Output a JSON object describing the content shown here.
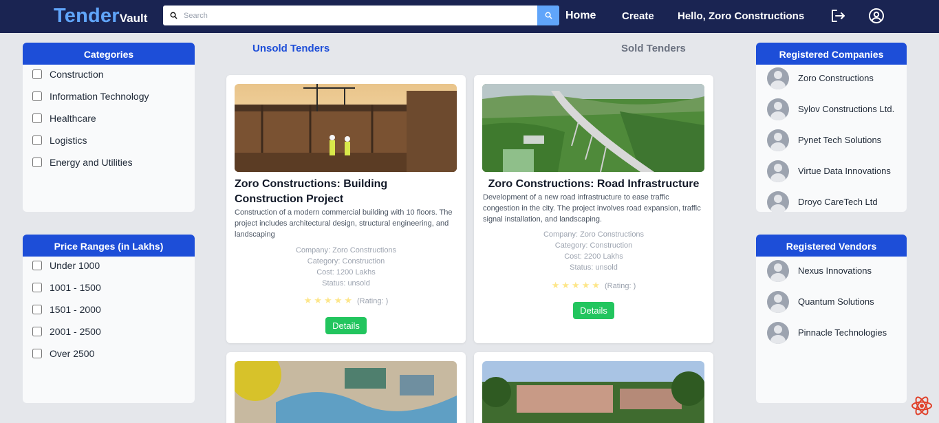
{
  "brand": {
    "main": "Tender",
    "sub": "Vault"
  },
  "search": {
    "placeholder": "Search"
  },
  "nav": {
    "home": "Home",
    "create": "Create",
    "greeting": "Hello, Zoro Constructions"
  },
  "categories": {
    "title": "Categories",
    "items": [
      "Construction",
      "Information Technology",
      "Healthcare",
      "Logistics",
      "Energy and Utilities"
    ]
  },
  "price_ranges": {
    "title": "Price Ranges (in Lakhs)",
    "items": [
      "Under 1000",
      "1001 - 1500",
      "1501 - 2000",
      "2001 - 2500",
      "Over 2500"
    ]
  },
  "tabs": {
    "unsold": "Unsold Tenders",
    "sold": "Sold Tenders"
  },
  "tenders": [
    {
      "title": "Zoro Constructions: Building Construction Project",
      "description": "Construction of a modern commercial building with 10 floors. The project includes architectural design, structural engineering, and landscaping",
      "company": "Company: Zoro Constructions",
      "category": "Category: Construction",
      "cost": "Cost: 1200 Lakhs",
      "status": "Status: unsold",
      "rating": "(Rating: )",
      "button": "Details"
    },
    {
      "title": "Zoro Constructions: Road Infrastructure",
      "description": "Development of a new road infrastructure to ease traffic congestion in the city. The project involves road expansion, traffic signal installation, and landscaping.",
      "company": "Company: Zoro Constructions",
      "category": "Category: Construction",
      "cost": "Cost: 2200 Lakhs",
      "status": "Status: unsold",
      "rating": "(Rating: )",
      "button": "Details"
    }
  ],
  "companies": {
    "title": "Registered Companies",
    "items": [
      "Zoro Constructions",
      "Sylov Constructions Ltd.",
      "Pynet Tech Solutions",
      "Virtue Data Innovations",
      "Droyo CareTech Ltd"
    ]
  },
  "vendors": {
    "title": "Registered Vendors",
    "items": [
      "Nexus Innovations",
      "Quantum Solutions",
      "Pinnacle Technologies"
    ]
  },
  "colors": {
    "navbar": "#1a2452",
    "accent": "#1d4ed8",
    "brand": "#60a5fa",
    "button": "#22c55e"
  }
}
